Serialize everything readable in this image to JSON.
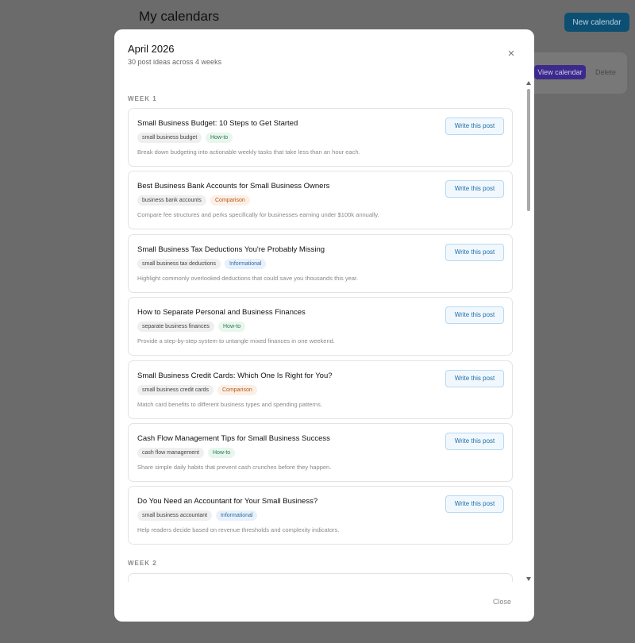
{
  "background": {
    "page_title": "My calendars",
    "new_calendar_label": "New calendar",
    "view_calendar_label": "View calendar",
    "delete_label": "Delete"
  },
  "modal": {
    "title": "April 2026",
    "subtitle": "30 post ideas across 4 weeks",
    "close_icon": "×",
    "footer_close_label": "Close",
    "write_label": "Write this post",
    "weeks": [
      {
        "label": "WEEK 1",
        "ideas": [
          {
            "title": "Small Business Budget: 10 Steps to Get Started",
            "keyword": "small business budget",
            "type": "How-to",
            "type_class": "type-howto",
            "description": "Break down budgeting into actionable weekly tasks that take less than an hour each."
          },
          {
            "title": "Best Business Bank Accounts for Small Business Owners",
            "keyword": "business bank accounts",
            "type": "Comparison",
            "type_class": "type-comparison",
            "description": "Compare fee structures and perks specifically for businesses earning under $100k annually."
          },
          {
            "title": "Small Business Tax Deductions You're Probably Missing",
            "keyword": "small business tax deductions",
            "type": "Informational",
            "type_class": "type-info",
            "description": "Highlight commonly overlooked deductions that could save you thousands this year."
          },
          {
            "title": "How to Separate Personal and Business Finances",
            "keyword": "separate business finances",
            "type": "How-to",
            "type_class": "type-howto",
            "description": "Provide a step-by-step system to untangle mixed finances in one weekend."
          },
          {
            "title": "Small Business Credit Cards: Which One Is Right for You?",
            "keyword": "small business credit cards",
            "type": "Comparison",
            "type_class": "type-comparison",
            "description": "Match card benefits to different business types and spending patterns."
          },
          {
            "title": "Cash Flow Management Tips for Small Business Success",
            "keyword": "cash flow management",
            "type": "How-to",
            "type_class": "type-howto",
            "description": "Share simple daily habits that prevent cash crunches before they happen."
          },
          {
            "title": "Do You Need an Accountant for Your Small Business?",
            "keyword": "small business accountant",
            "type": "Informational",
            "type_class": "type-info",
            "description": "Help readers decide based on revenue thresholds and complexity indicators."
          }
        ]
      },
      {
        "label": "WEEK 2",
        "ideas": []
      }
    ]
  }
}
